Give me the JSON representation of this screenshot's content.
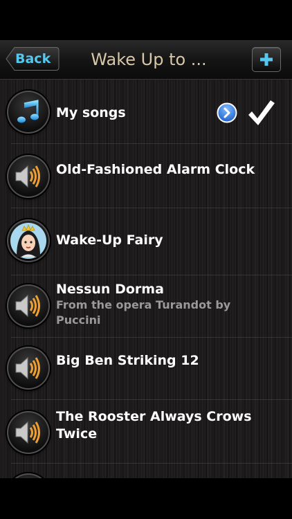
{
  "navbar": {
    "back_label": "Back",
    "title": "Wake Up to ...",
    "add_icon": "plus-icon"
  },
  "sounds": [
    {
      "title": "My songs",
      "subtitle": "",
      "icon": "music-note-icon",
      "selected": true
    },
    {
      "title": "Old-Fashioned Alarm Clock",
      "subtitle": "",
      "icon": "speaker-icon"
    },
    {
      "title": "Wake-Up Fairy",
      "subtitle": "",
      "icon": "fairy-avatar-icon"
    },
    {
      "title": "Nessun Dorma",
      "subtitle": "From the opera Turandot by Puccini",
      "icon": "speaker-icon"
    },
    {
      "title": "Big Ben Striking 12",
      "subtitle": "",
      "icon": "speaker-icon"
    },
    {
      "title": "The Rooster Always Crows",
      "title_line2": "Twice",
      "subtitle": "",
      "icon": "speaker-icon"
    }
  ],
  "colors": {
    "accent_blue": "#56c8ee",
    "title_tan": "#d8c7a8",
    "speaker_orange": "#f0a030"
  }
}
